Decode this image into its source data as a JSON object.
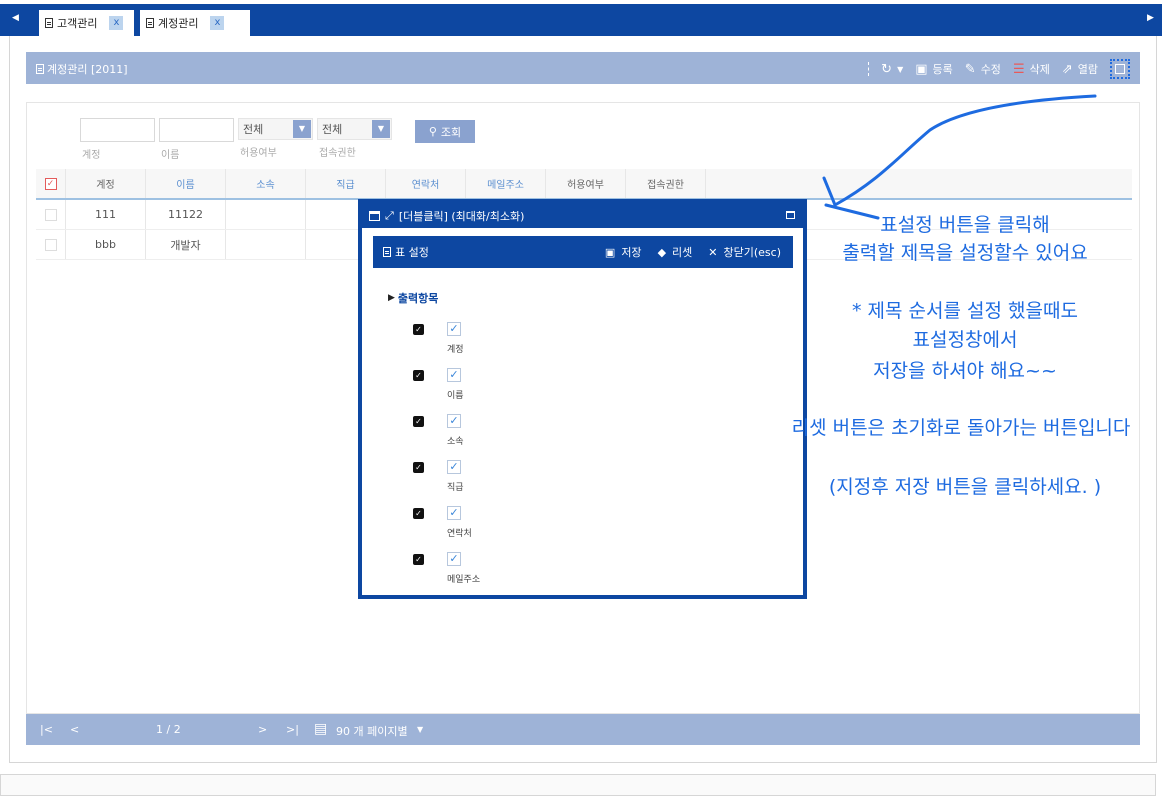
{
  "tabs": [
    {
      "label": "고객관리",
      "close": "x"
    },
    {
      "label": "계정관리",
      "close": "x"
    }
  ],
  "panel": {
    "title": "계정관리 [2011]"
  },
  "toolbar": {
    "register": "등록",
    "edit": "수정",
    "delete": "삭제",
    "view": "열람"
  },
  "filter": {
    "account_caption": "계정",
    "name_caption": "이름",
    "allow_value": "전체",
    "allow_caption": "허용여부",
    "access_value": "전체",
    "access_caption": "접속권한",
    "search_label": "조회"
  },
  "grid": {
    "columns": [
      "계정",
      "이름",
      "소속",
      "직급",
      "연락처",
      "메일주소",
      "허용여부",
      "접속권한"
    ],
    "rows": [
      {
        "account": "111",
        "name": "11122"
      },
      {
        "account": "bbb",
        "name": "개발자"
      }
    ]
  },
  "pager": {
    "page": "1 / 2",
    "page_size": "90 개 페이지별"
  },
  "modal": {
    "title": "[더블클릭] (최대화/최소화)",
    "bar_title": "표 설정",
    "save": "저장",
    "reset": "리셋",
    "close": "창닫기(esc)",
    "section": "출력항목",
    "items": [
      "계정",
      "이름",
      "소속",
      "직급",
      "연락처",
      "메일주소"
    ]
  },
  "annotations": {
    "line1": "표설정 버튼을 클릭해",
    "line2": "출력할 제목을 설정할수 있어요",
    "line3": "* 제목 순서를 설정 했을때도",
    "line4": "표설정창에서",
    "line5": "저장을 하셔야 해요~~",
    "line6": "리셋 버튼은 초기화로 돌아가는 버튼입니다",
    "line7": "(지정후 저장 버튼을 클릭하세요. )"
  },
  "colors": {
    "primary": "#0d47a1",
    "header": "#9eb3d7",
    "annotation": "#1e6be0"
  }
}
